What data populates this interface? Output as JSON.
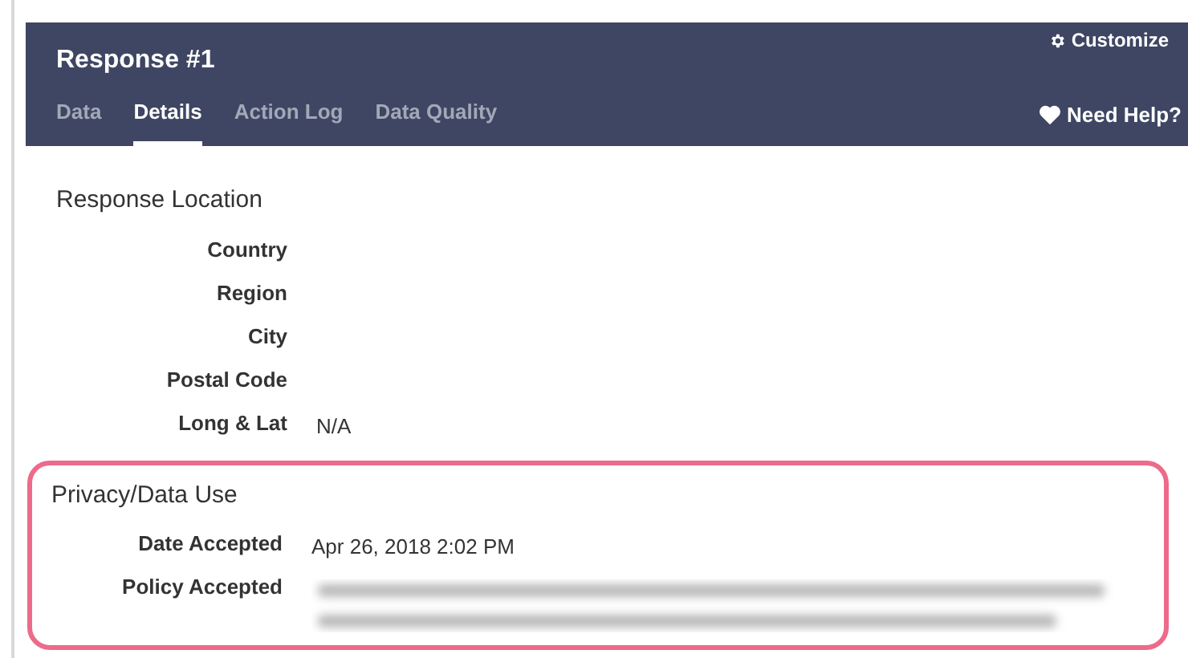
{
  "header": {
    "title": "Response #1",
    "customize": "Customize",
    "help": "Need Help?"
  },
  "tabs": [
    {
      "label": "Data",
      "selected": false
    },
    {
      "label": "Details",
      "selected": true
    },
    {
      "label": "Action Log",
      "selected": false
    },
    {
      "label": "Data Quality",
      "selected": false
    }
  ],
  "sections": [
    {
      "title": "Response Location",
      "highlighted": false,
      "rows": [
        {
          "label": "Country"
        },
        {
          "label": "Region"
        },
        {
          "label": "City"
        },
        {
          "label": "Postal Code"
        },
        {
          "label": "Long & Lat",
          "value": "N/A"
        }
      ]
    },
    {
      "title": "Privacy/Data Use",
      "highlighted": true,
      "rows": [
        {
          "label": "Date Accepted",
          "value": "Apr 26, 2018 2:02 PM"
        },
        {
          "label": "Policy Accepted",
          "kind": "blurred"
        }
      ]
    }
  ]
}
